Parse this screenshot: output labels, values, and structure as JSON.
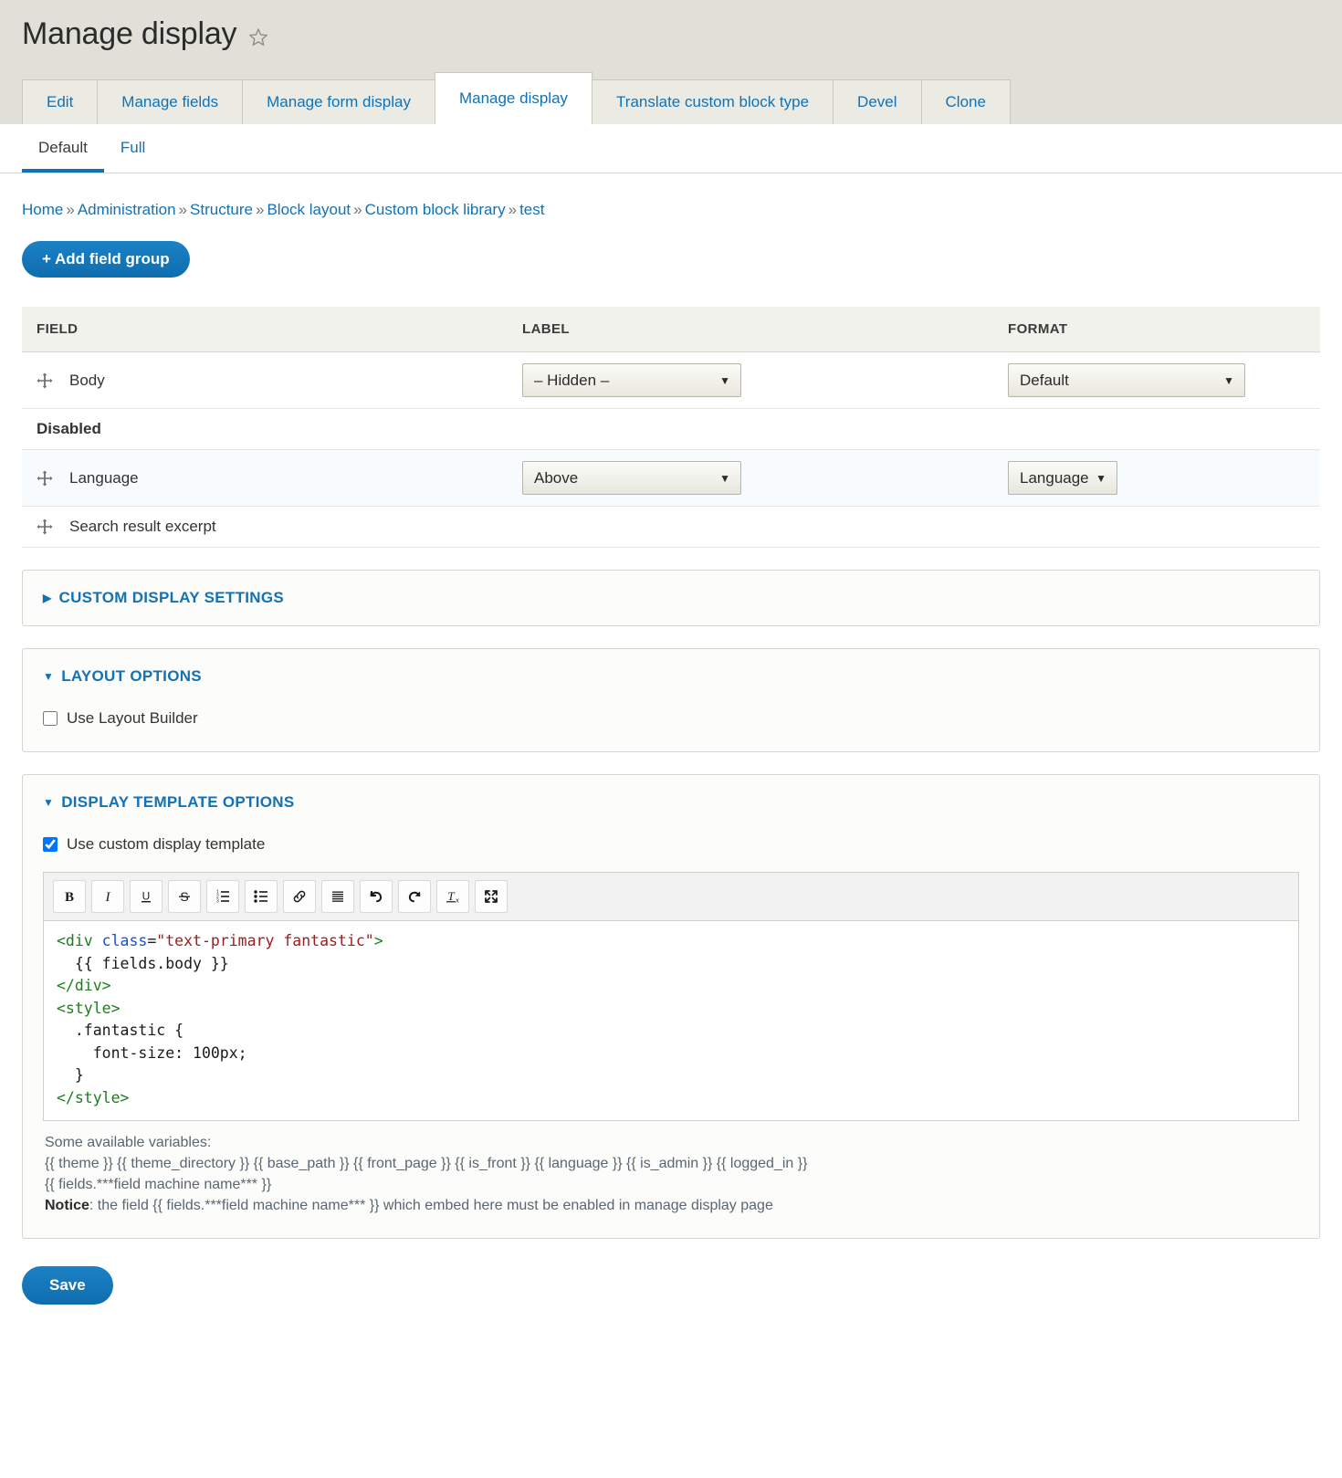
{
  "header": {
    "title": "Manage display",
    "star_icon": "star-outline-icon"
  },
  "primary_tabs": [
    {
      "label": "Edit",
      "active": false
    },
    {
      "label": "Manage fields",
      "active": false
    },
    {
      "label": "Manage form display",
      "active": false
    },
    {
      "label": "Manage display",
      "active": true
    },
    {
      "label": "Translate custom block type",
      "active": false
    },
    {
      "label": "Devel",
      "active": false
    },
    {
      "label": "Clone",
      "active": false
    }
  ],
  "secondary_tabs": [
    {
      "label": "Default",
      "active": true
    },
    {
      "label": "Full",
      "active": false
    }
  ],
  "breadcrumb": {
    "separator": "»",
    "items": [
      "Home",
      "Administration",
      "Structure",
      "Block layout",
      "Custom block library",
      "test"
    ]
  },
  "actions": {
    "add_field_group": "+ Add field group",
    "save": "Save"
  },
  "table": {
    "headers": [
      "FIELD",
      "LABEL",
      "FORMAT"
    ],
    "rows": [
      {
        "type": "field",
        "name": "Body",
        "label_select": "– Hidden –",
        "format_select": "Default"
      },
      {
        "type": "region",
        "name": "Disabled"
      },
      {
        "type": "field",
        "name": "Language",
        "label_select": "Above",
        "format_select": "Language"
      },
      {
        "type": "field",
        "name": "Search result excerpt",
        "label_select": null,
        "format_select": null
      }
    ]
  },
  "custom_display_settings": {
    "title": "CUSTOM DISPLAY SETTINGS",
    "marker": "▶",
    "open": false
  },
  "layout_options": {
    "title": "LAYOUT OPTIONS",
    "marker": "▼",
    "open": true,
    "use_layout_builder_label": "Use Layout Builder",
    "use_layout_builder_checked": false
  },
  "display_template_options": {
    "title": "DISPLAY TEMPLATE OPTIONS",
    "marker": "▼",
    "open": true,
    "use_custom_display_template_label": "Use custom display template",
    "use_custom_display_template_checked": true,
    "toolbar": [
      {
        "name": "bold-icon",
        "title": "Bold"
      },
      {
        "name": "italic-icon",
        "title": "Italic"
      },
      {
        "name": "underline-icon",
        "title": "Underline"
      },
      {
        "name": "strikethrough-icon",
        "title": "Strikethrough"
      },
      {
        "name": "numbered-list-icon",
        "title": "Numbered List"
      },
      {
        "name": "bulleted-list-icon",
        "title": "Bulleted List"
      },
      {
        "name": "link-icon",
        "title": "Link"
      },
      {
        "name": "source-icon",
        "title": "Source"
      },
      {
        "name": "undo-icon",
        "title": "Undo"
      },
      {
        "name": "redo-icon",
        "title": "Redo"
      },
      {
        "name": "remove-format-icon",
        "title": "Remove Format"
      },
      {
        "name": "fullscreen-icon",
        "title": "Maximize"
      }
    ],
    "code_lines": [
      [
        {
          "t": "tag",
          "s": "<div "
        },
        {
          "t": "attr",
          "s": "class"
        },
        {
          "t": "plain",
          "s": "="
        },
        {
          "t": "val",
          "s": "\"text-primary fantastic\""
        },
        {
          "t": "tag",
          "s": ">"
        }
      ],
      [
        {
          "t": "plain",
          "s": "  {{ fields.body }}"
        }
      ],
      [
        {
          "t": "tag",
          "s": "</div>"
        }
      ],
      [
        {
          "t": "tag",
          "s": "<style>"
        }
      ],
      [
        {
          "t": "plain",
          "s": "  .fantastic {"
        }
      ],
      [
        {
          "t": "plain",
          "s": "    font-size: 100px;"
        }
      ],
      [
        {
          "t": "plain",
          "s": "  }"
        }
      ],
      [
        {
          "t": "tag",
          "s": "</style>"
        }
      ]
    ],
    "help": {
      "line1": "Some available variables:",
      "line2": "{{ theme }} {{ theme_directory }} {{ base_path }} {{ front_page }} {{ is_front }} {{ language }} {{ is_admin }} {{ logged_in }}",
      "line3": "{{ fields.***field machine name*** }}",
      "notice_label": "Notice",
      "notice_text": ": the field {{ fields.***field machine name*** }} which embed here must be enabled in manage display page"
    }
  }
}
